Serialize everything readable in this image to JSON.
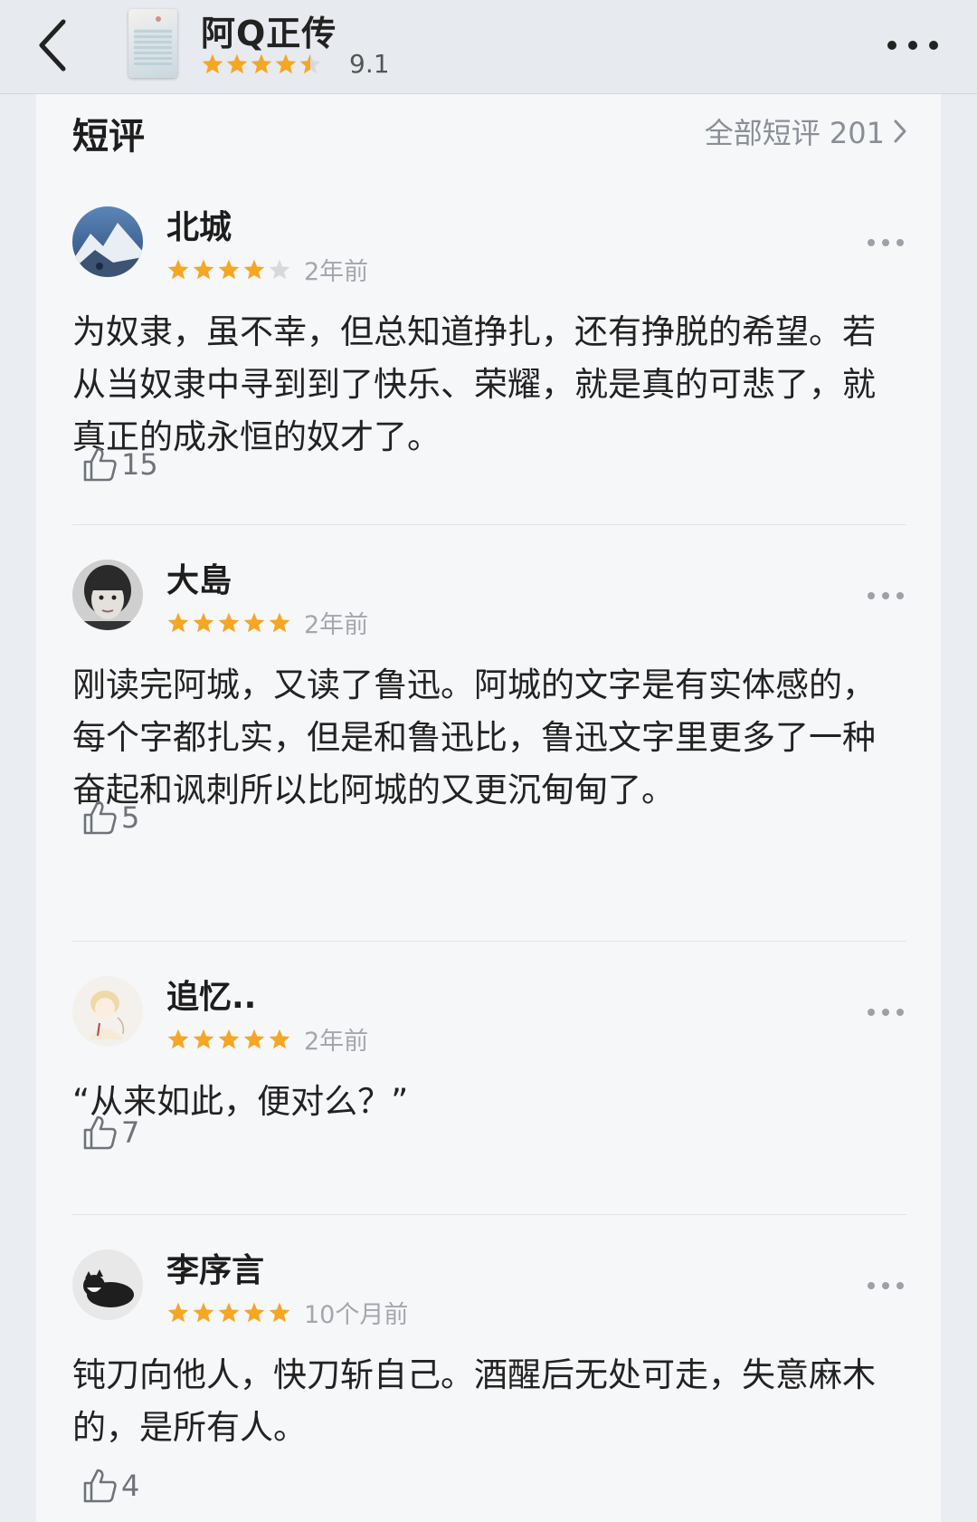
{
  "header": {
    "back_icon": "chevron-left-icon",
    "book_title": "阿Q正传",
    "book_rating": "9.1",
    "book_stars": 4.5,
    "more_icon": "more-horizontal-icon"
  },
  "section": {
    "title": "短评",
    "all_reviews_label": "全部短评 201"
  },
  "colors": {
    "star": "#f5a623",
    "star_empty": "#d9d9d9"
  },
  "reviews": [
    {
      "user": "北城",
      "stars": 4,
      "time": "2年前",
      "text": "为奴隶，虽不幸，但总知道挣扎，还有挣脱的希望。若从当奴隶中寻到到了快乐、荣耀，就是真的可悲了，就真正的成永恒的奴才了。",
      "likes": "15"
    },
    {
      "user": "大島",
      "stars": 5,
      "time": "2年前",
      "text": "刚读完阿城，又读了鲁迅。阿城的文字是有实体感的，每个字都扎实，但是和鲁迅比，鲁迅文字里更多了一种奋起和讽刺所以比阿城的又更沉甸甸了。",
      "likes": "5"
    },
    {
      "user": "追忆..",
      "stars": 5,
      "time": "2年前",
      "text": "“从来如此，便对么？”",
      "likes": "7"
    },
    {
      "user": "李序言",
      "stars": 5,
      "time": "10个月前",
      "text": "钝刀向他人，快刀斩自己。酒醒后无处可走，失意麻木的，是所有人。",
      "likes": "4"
    }
  ]
}
